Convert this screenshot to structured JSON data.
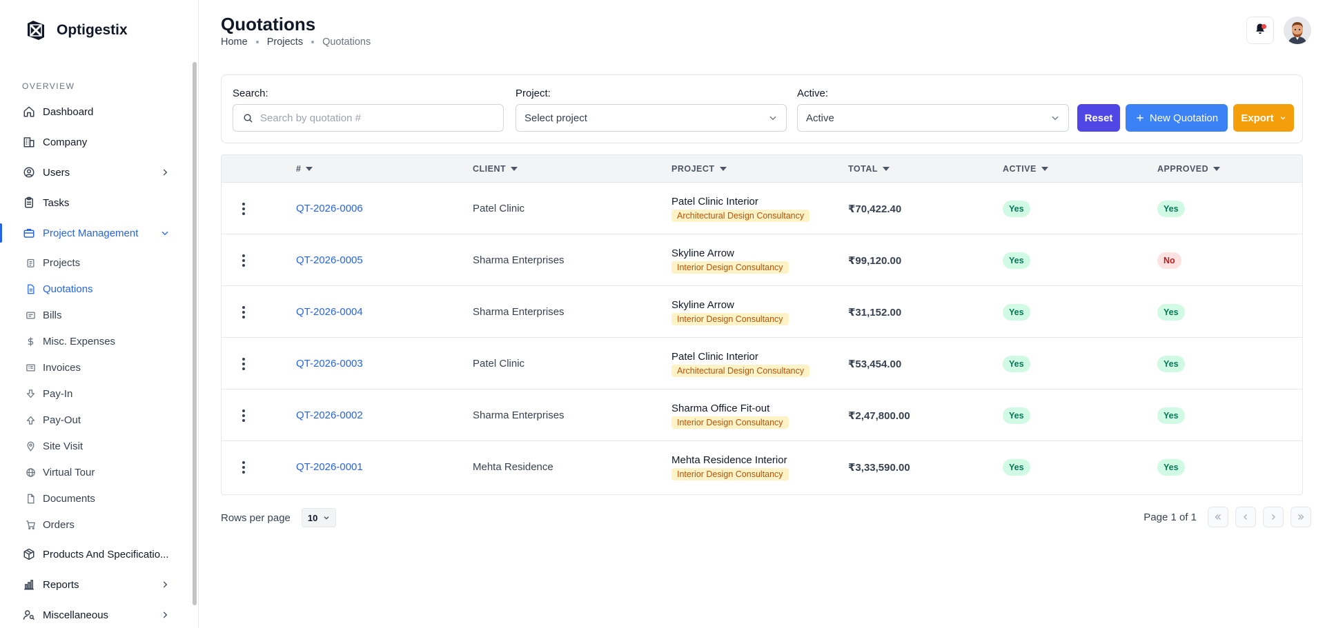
{
  "brand": {
    "name": "Optigestix"
  },
  "sidebar": {
    "section_label": "OVERVIEW",
    "items": [
      {
        "label": "Dashboard",
        "icon": "home-icon"
      },
      {
        "label": "Company",
        "icon": "building-icon"
      },
      {
        "label": "Users",
        "icon": "user-circle-icon"
      },
      {
        "label": "Tasks",
        "icon": "clipboard-icon"
      },
      {
        "label": "Project Management",
        "icon": "briefcase-icon"
      },
      {
        "label": "Products And Specificatio...",
        "icon": "package-icon"
      },
      {
        "label": "Reports",
        "icon": "bar-chart-icon"
      },
      {
        "label": "Miscellaneous",
        "icon": "user-search-icon"
      }
    ],
    "sub_items": [
      {
        "label": "Projects",
        "icon": "clipboard-list-icon"
      },
      {
        "label": "Quotations",
        "icon": "file-text-icon"
      },
      {
        "label": "Bills",
        "icon": "receipt-icon"
      },
      {
        "label": "Misc. Expenses",
        "icon": "dollar-icon"
      },
      {
        "label": "Invoices",
        "icon": "invoice-icon"
      },
      {
        "label": "Pay-In",
        "icon": "arrow-in-icon"
      },
      {
        "label": "Pay-Out",
        "icon": "arrow-out-icon"
      },
      {
        "label": "Site Visit",
        "icon": "map-pin-icon"
      },
      {
        "label": "Virtual Tour",
        "icon": "globe-icon"
      },
      {
        "label": "Documents",
        "icon": "document-icon"
      },
      {
        "label": "Orders",
        "icon": "cart-icon"
      }
    ]
  },
  "header": {
    "title": "Quotations",
    "breadcrumb": [
      "Home",
      "Projects",
      "Quotations"
    ]
  },
  "filters": {
    "search_label": "Search:",
    "search_placeholder": "Search by quotation #",
    "project_label": "Project:",
    "project_value": "Select project",
    "active_label": "Active:",
    "active_value": "Active",
    "reset_label": "Reset",
    "new_label": "New Quotation",
    "export_label": "Export"
  },
  "table": {
    "columns": [
      "#",
      "CLIENT",
      "PROJECT",
      "TOTAL",
      "ACTIVE",
      "APPROVED"
    ],
    "rows": [
      {
        "number": "QT-2026-0006",
        "client": "Patel Clinic",
        "project": "Patel Clinic Interior",
        "category": "Architectural Design Consultancy",
        "total": "₹70,422.40",
        "active": "Yes",
        "approved": "Yes"
      },
      {
        "number": "QT-2026-0005",
        "client": "Sharma Enterprises",
        "project": "Skyline Arrow",
        "category": "Interior Design Consultancy",
        "total": "₹99,120.00",
        "active": "Yes",
        "approved": "No"
      },
      {
        "number": "QT-2026-0004",
        "client": "Sharma Enterprises",
        "project": "Skyline Arrow",
        "category": "Interior Design Consultancy",
        "total": "₹31,152.00",
        "active": "Yes",
        "approved": "Yes"
      },
      {
        "number": "QT-2026-0003",
        "client": "Patel Clinic",
        "project": "Patel Clinic Interior",
        "category": "Architectural Design Consultancy",
        "total": "₹53,454.00",
        "active": "Yes",
        "approved": "Yes"
      },
      {
        "number": "QT-2026-0002",
        "client": "Sharma Enterprises",
        "project": "Sharma Office Fit-out",
        "category": "Interior Design Consultancy",
        "total": "₹2,47,800.00",
        "active": "Yes",
        "approved": "Yes"
      },
      {
        "number": "QT-2026-0001",
        "client": "Mehta Residence",
        "project": "Mehta Residence Interior",
        "category": "Interior Design Consultancy",
        "total": "₹3,33,590.00",
        "active": "Yes",
        "approved": "Yes"
      }
    ]
  },
  "pagination": {
    "rows_per_page_label": "Rows per page",
    "rows_per_page_value": "10",
    "page_text": "Page 1 of 1"
  },
  "colors": {
    "primary": "#2563eb",
    "reset": "#4f46e5",
    "export": "#f59e0b",
    "yes_bg": "#d1fae5",
    "no_bg": "#fee2e2",
    "tag_bg": "#fef3c7"
  }
}
